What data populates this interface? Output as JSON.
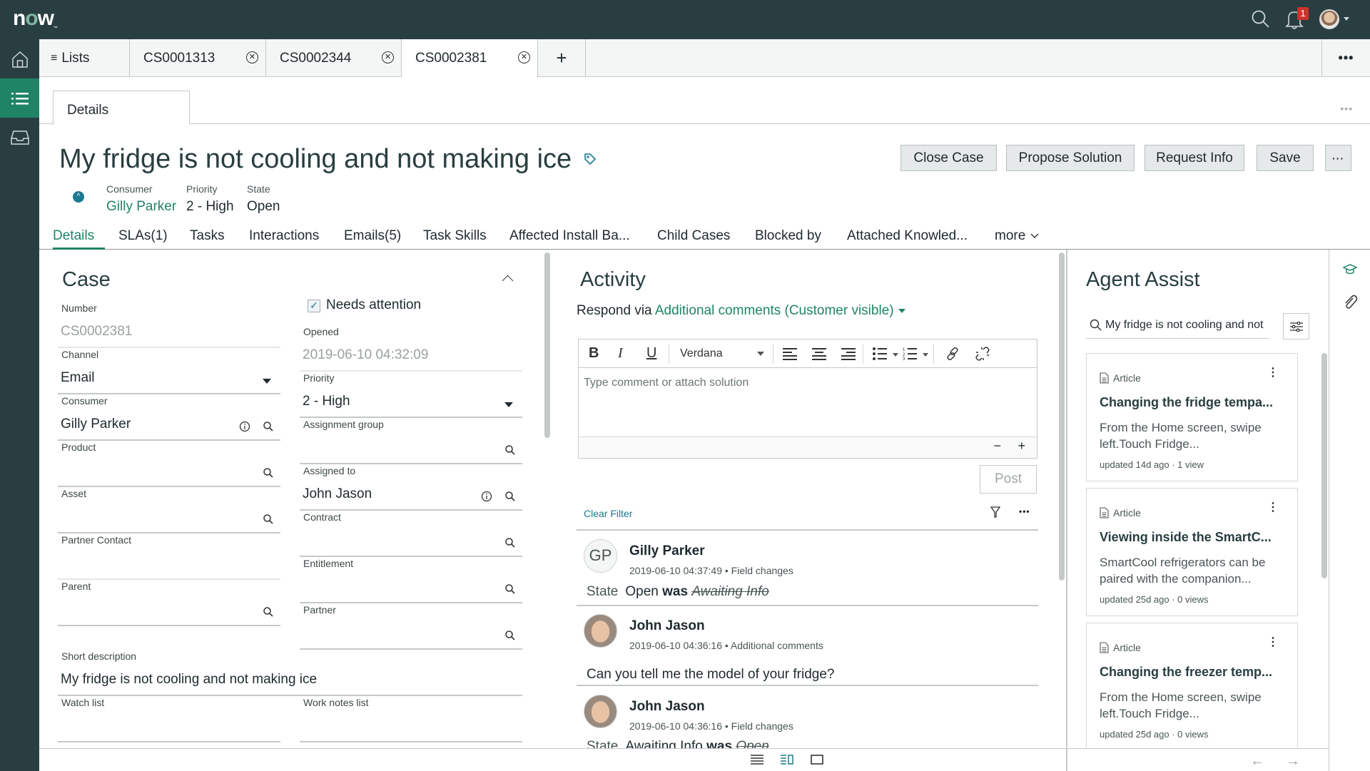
{
  "app": {
    "logo": "now",
    "notification_count": "1"
  },
  "rail": {
    "items": [
      "home",
      "lists",
      "inbox"
    ],
    "active": "lists"
  },
  "workspace_tabs": [
    {
      "label": "Lists",
      "closable": false
    },
    {
      "label": "CS0001313",
      "closable": true
    },
    {
      "label": "CS0002344",
      "closable": true
    },
    {
      "label": "CS0002381",
      "closable": true,
      "active": true
    }
  ],
  "subtab": {
    "label": "Details"
  },
  "record": {
    "title": "My fridge is not cooling and not making ice",
    "highlights": [
      {
        "label": "Consumer",
        "value": "Gilly Parker"
      },
      {
        "label": "Priority",
        "value": "2 - High"
      },
      {
        "label": "State",
        "value": "Open"
      }
    ],
    "buttons": {
      "close_case": "Close Case",
      "propose_solution": "Propose Solution",
      "request_info": "Request Info",
      "save": "Save",
      "more": "···"
    }
  },
  "related_tabs": [
    "Details",
    "SLAs(1)",
    "Tasks",
    "Interactions",
    "Emails(5)",
    "Task Skills",
    "Affected Install Ba...",
    "Child Cases",
    "Blocked by",
    "Attached Knowled...",
    "more"
  ],
  "case": {
    "title": "Case",
    "needs_attention": {
      "label": "Needs attention",
      "checked": true
    },
    "left_fields": [
      {
        "label": "Number",
        "value": "CS0002381"
      },
      {
        "label": "Channel",
        "value": "Email"
      },
      {
        "label": "Consumer",
        "value": "Gilly Parker"
      },
      {
        "label": "Product",
        "value": ""
      },
      {
        "label": "Asset",
        "value": ""
      },
      {
        "label": "Partner Contact",
        "value": ""
      },
      {
        "label": "Parent",
        "value": ""
      }
    ],
    "right_fields": [
      {
        "label": "Opened",
        "value": "2019-06-10 04:32:09"
      },
      {
        "label": "Priority",
        "value": "2 - High"
      },
      {
        "label": "Assignment group",
        "value": ""
      },
      {
        "label": "Assigned to",
        "value": "John Jason"
      },
      {
        "label": "Contract",
        "value": ""
      },
      {
        "label": "Entitlement",
        "value": ""
      },
      {
        "label": "Partner",
        "value": ""
      }
    ],
    "short_description": {
      "label": "Short description",
      "value": "My fridge is not cooling and not making ice"
    },
    "watch_list": {
      "label": "Watch list",
      "value": ""
    },
    "work_notes_list": {
      "label": "Work notes list",
      "value": ""
    }
  },
  "activity": {
    "title": "Activity",
    "respond_via_label": "Respond via",
    "respond_via_value": "Additional comments (Customer visible)",
    "editor": {
      "font": "Verdana",
      "placeholder": "Type comment or attach solution"
    },
    "post_label": "Post",
    "clear_filter": "Clear Filter",
    "entries": [
      {
        "initials": "GP",
        "author": "Gilly Parker",
        "meta": "2019-06-10 04:37:49 • Field changes",
        "field": "State",
        "new": "Open",
        "was": "was",
        "old": "Awaiting Info"
      },
      {
        "initials": "",
        "author": "John Jason",
        "meta": "2019-06-10 04:36:16 • Additional comments",
        "comment": "Can you tell me the model of your fridge?"
      },
      {
        "initials": "",
        "author": "John Jason",
        "meta": "2019-06-10 04:36:16 • Field changes",
        "field": "State",
        "new": "Awaiting Info",
        "was": "was",
        "old": "Open"
      }
    ]
  },
  "agent_assist": {
    "title": "Agent Assist",
    "search_value": "My fridge is not cooling and not making ice",
    "cards": [
      {
        "type": "Article",
        "title": "Changing the fridge tempa...",
        "snippet": "From the Home screen, swipe left.Touch Fridge...",
        "updated": "updated 14d ago · 1 view"
      },
      {
        "type": "Article",
        "title": "Viewing inside the SmartC...",
        "snippet": "SmartCool refrigerators can be paired with the companion...",
        "updated": "updated 25d ago · 0 views"
      },
      {
        "type": "Article",
        "title": "Changing the freezer temp...",
        "snippet": "From the Home screen, swipe left.Touch Fridge...",
        "updated": "updated 25d ago · 0 views"
      }
    ]
  },
  "colors": {
    "header": "#293e40",
    "accent": "#1f8466",
    "link": "#1c7a8f",
    "badge": "#d0312d"
  }
}
